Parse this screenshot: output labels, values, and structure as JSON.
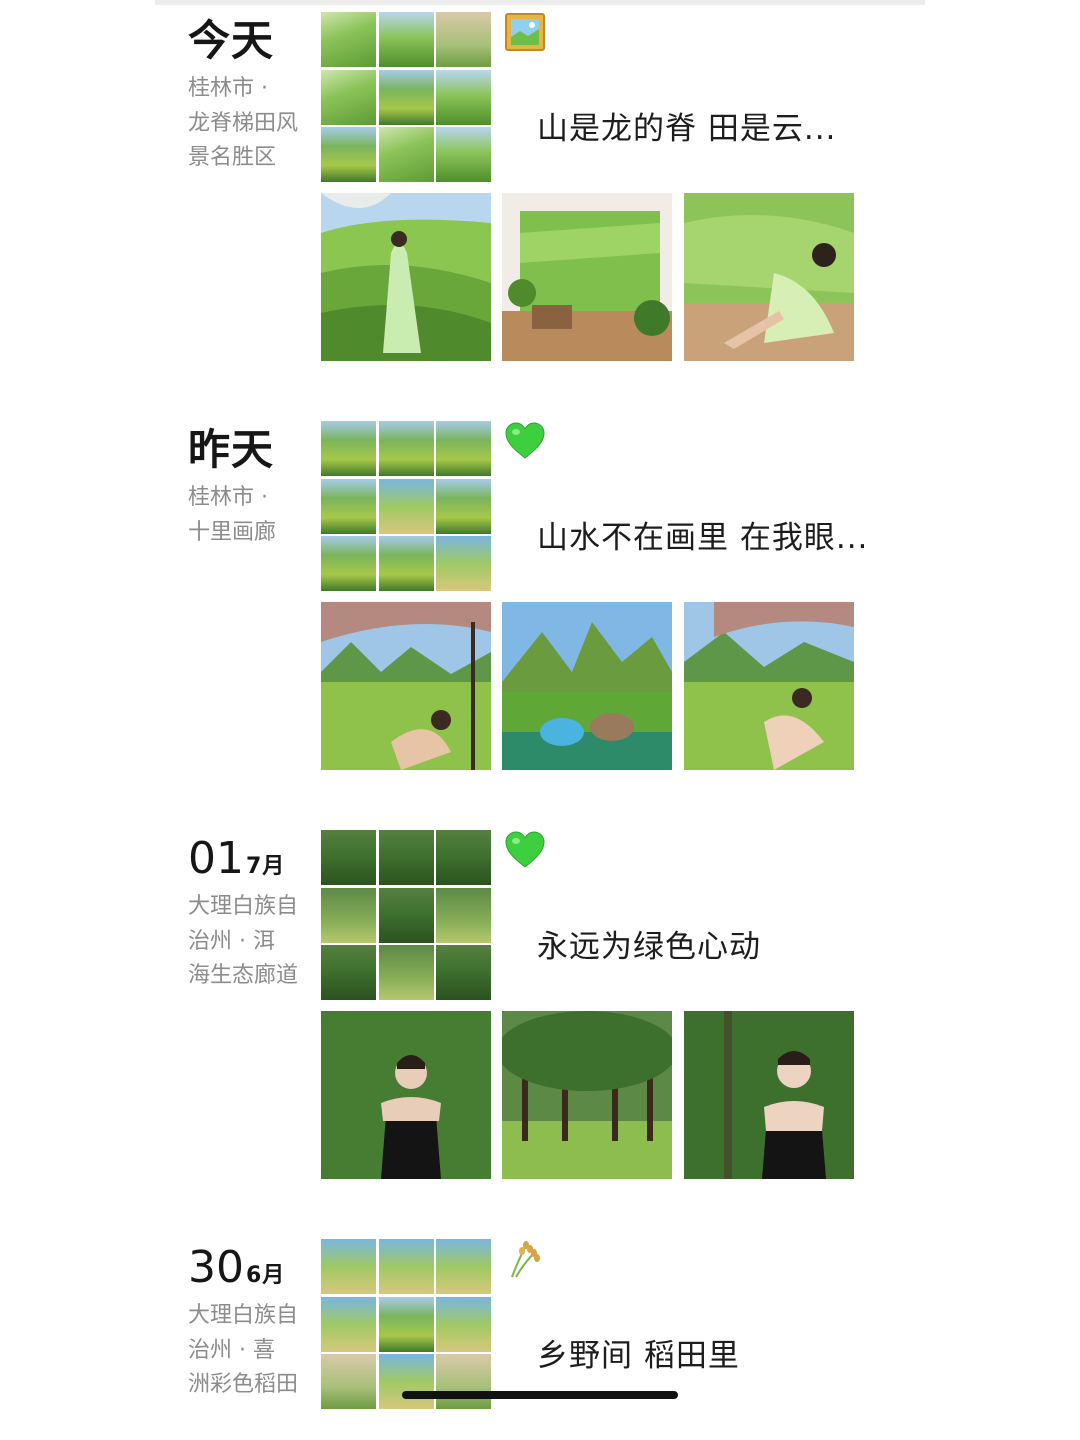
{
  "entries": [
    {
      "date_text": "今天",
      "location_lines": [
        "桂林市 ·",
        "龙脊梯田风",
        "景名胜区"
      ],
      "emoji": "framed-picture-emoji",
      "caption": "山是龙的脊  田是云..."
    },
    {
      "date_text": "昨天",
      "location_lines": [
        "桂林市 ·",
        "十里画廊"
      ],
      "emoji": "green-heart-emoji",
      "caption": "山水不在画里 在我眼..."
    },
    {
      "date_day": "01",
      "date_month": "7月",
      "location_lines": [
        "大理白族自",
        "治州 · 洱",
        "海生态廊道"
      ],
      "emoji": "green-heart-emoji",
      "caption": "永远为绿色心动"
    },
    {
      "date_day": "30",
      "date_month": "6月",
      "location_lines": [
        "大理白族自",
        "治州 · 喜",
        "洲彩色稻田"
      ],
      "emoji": "sheaf-of-rice-emoji",
      "caption": "乡野间    稻田里"
    }
  ],
  "colors": {
    "date_text": "#161616",
    "location_text": "#8c8c8c",
    "caption_text": "#1d1d1d",
    "heart": "#3ecf3e"
  }
}
